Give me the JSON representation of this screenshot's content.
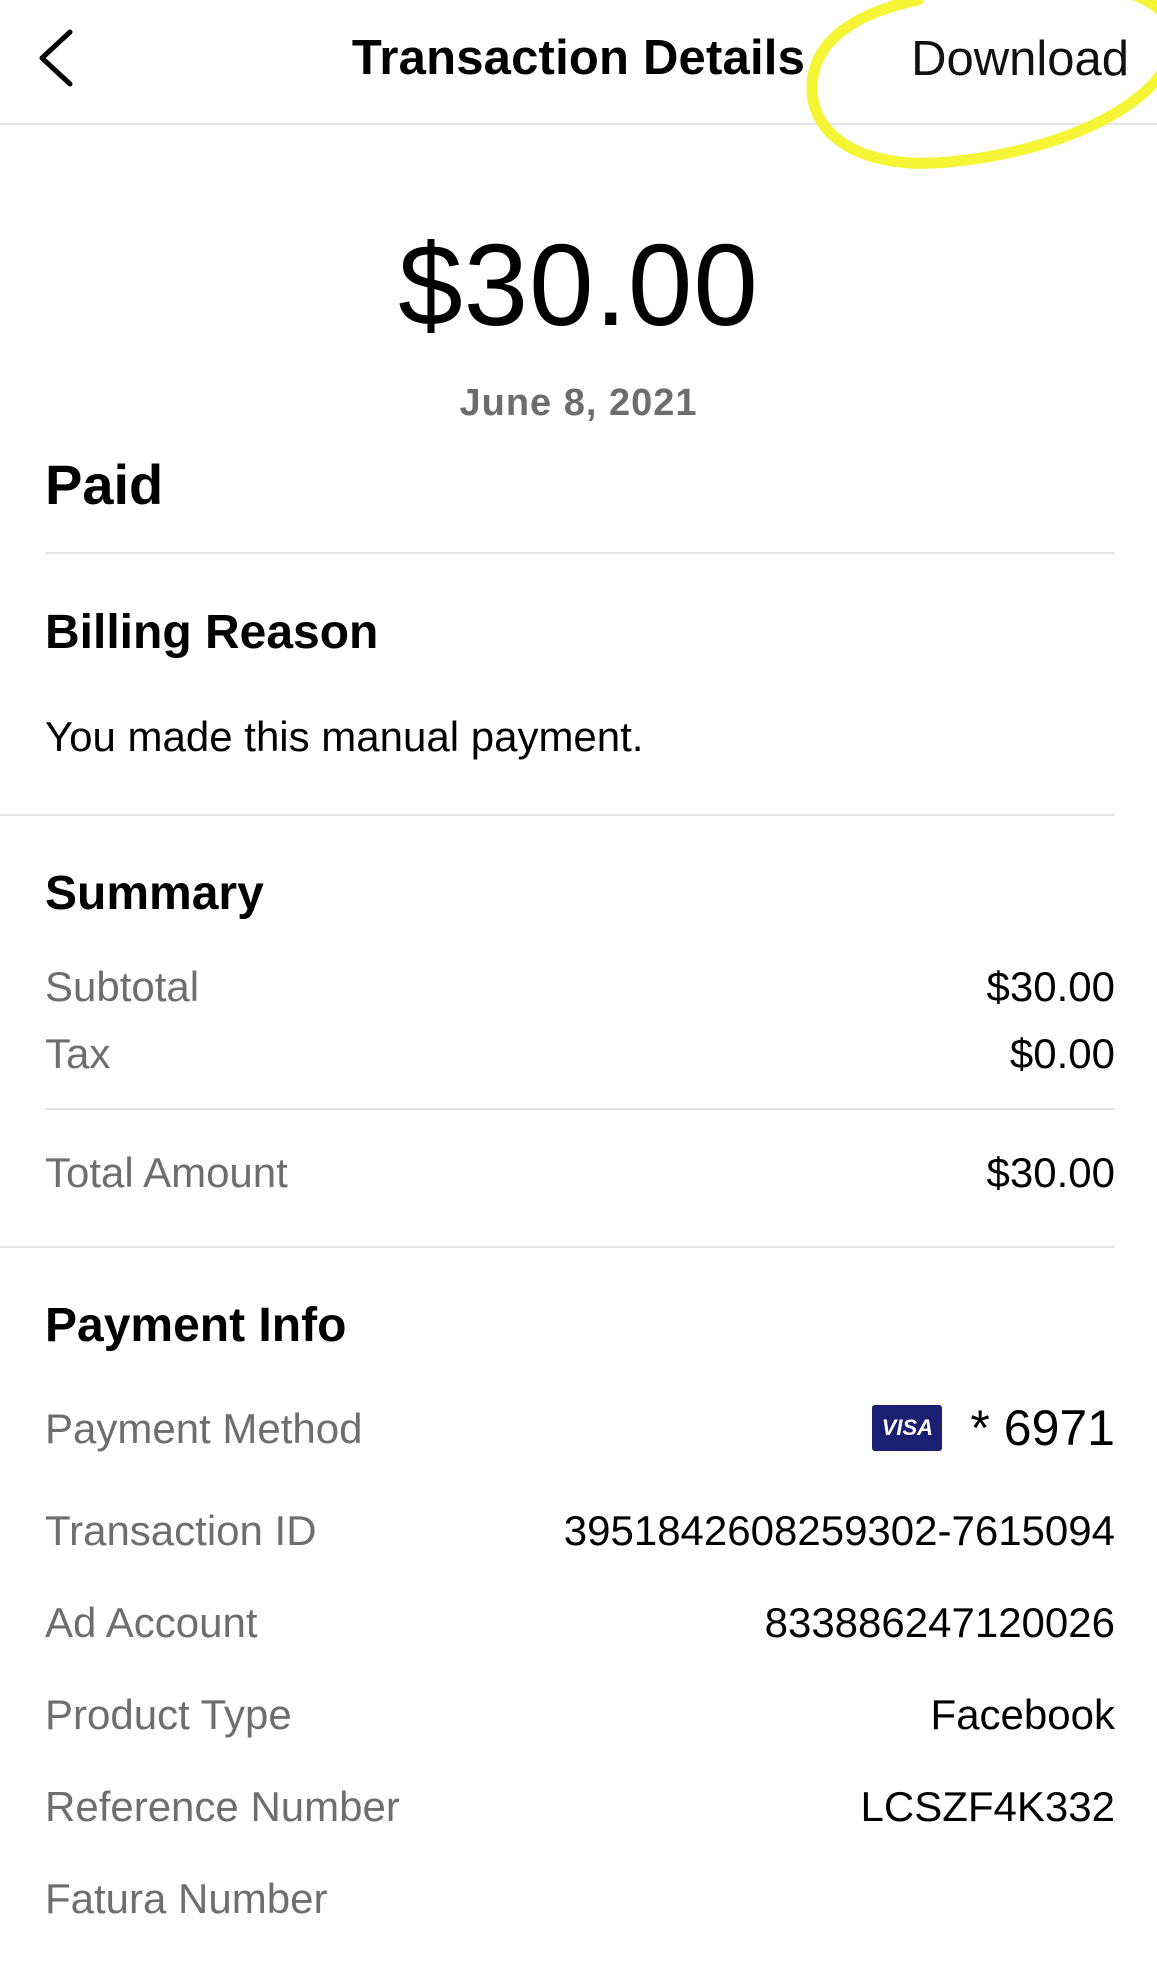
{
  "header": {
    "title": "Transaction Details",
    "download_label": "Download",
    "highlight_color": "#f5f535"
  },
  "transaction": {
    "amount": "$30.00",
    "date": "June 8, 2021",
    "status": "Paid"
  },
  "billing": {
    "title": "Billing Reason",
    "text": "You made this manual payment."
  },
  "summary": {
    "title": "Summary",
    "rows": [
      {
        "label": "Subtotal",
        "value": "$30.00"
      },
      {
        "label": "Tax",
        "value": "$0.00"
      }
    ],
    "total": {
      "label": "Total Amount",
      "value": "$30.00"
    }
  },
  "payment_info": {
    "title": "Payment Info",
    "method": {
      "label": "Payment Method",
      "card_brand": "VISA",
      "card_last4": "* 6971",
      "card_color": "#1a1f71"
    },
    "rows": [
      {
        "label": "Transaction ID",
        "value": "3951842608259302-7615094"
      },
      {
        "label": "Ad Account",
        "value": "833886247120026"
      },
      {
        "label": "Product Type",
        "value": "Facebook"
      },
      {
        "label": "Reference Number",
        "value": "LCSZF4K332"
      },
      {
        "label": "Fatura Number",
        "value": ""
      }
    ]
  }
}
